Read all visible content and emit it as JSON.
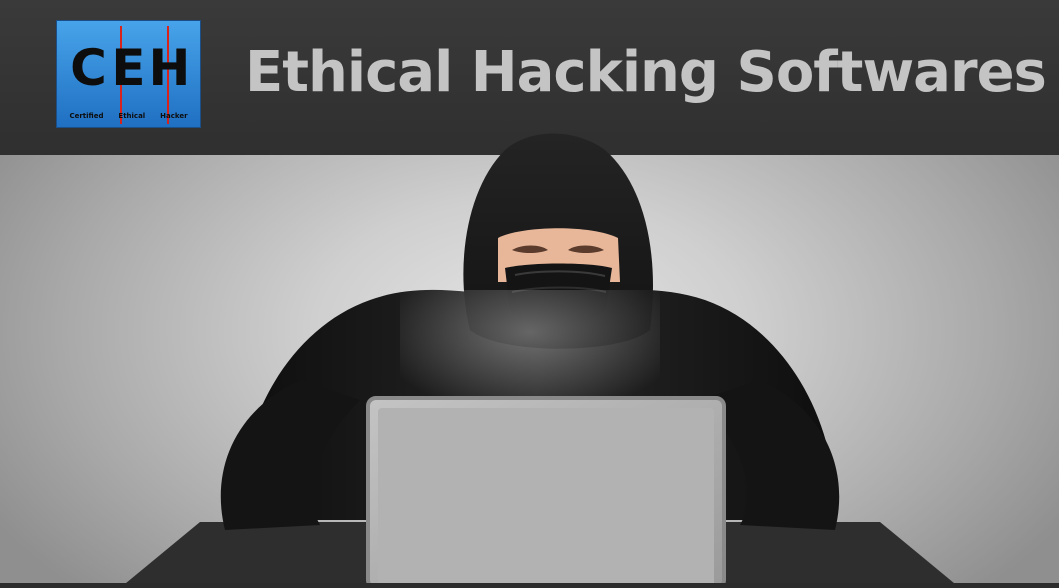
{
  "logo": {
    "letters": [
      "C",
      "E",
      "H"
    ],
    "subtext": [
      "Certified",
      "Ethical",
      "Hacker"
    ],
    "colors": {
      "background": "#2f86d8",
      "bar": "#d8231d",
      "text": "#0d0d0d"
    }
  },
  "title": "Ethical Hacking Softwares",
  "illustration": {
    "subject": "hooded-figure-with-laptop-icon"
  },
  "colors": {
    "header": "#333333",
    "title": "#c4c4c4",
    "hood": "#1b1b1b"
  }
}
